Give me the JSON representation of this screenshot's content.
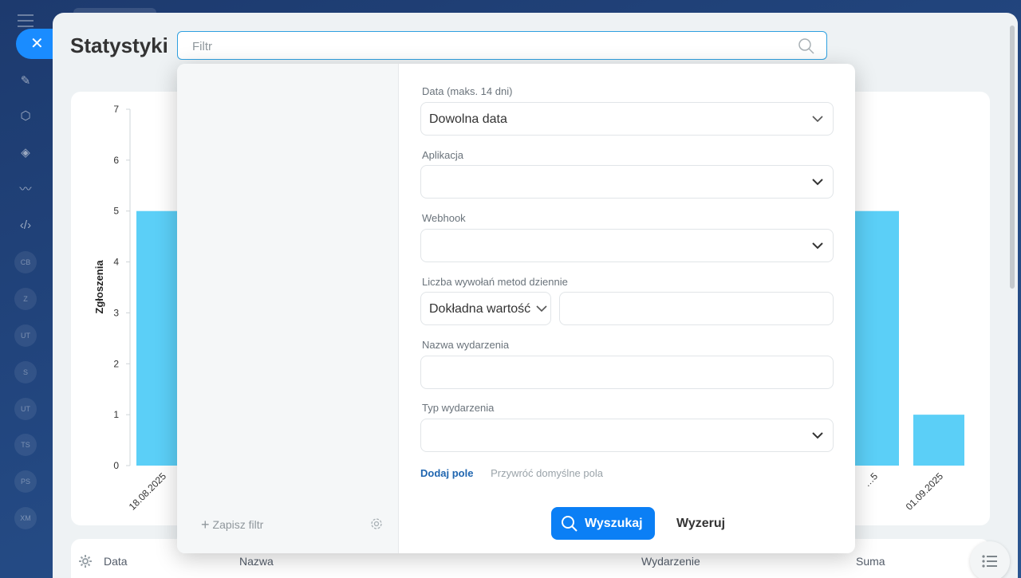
{
  "page": {
    "title": "Statystyki",
    "filter_placeholder": "Filtr"
  },
  "filter_popup": {
    "fields": [
      {
        "label": "Data (maks. 14 dni)",
        "value": "Dowolna data"
      },
      {
        "label": "Aplikacja",
        "value": ""
      },
      {
        "label": "Webhook",
        "value": ""
      },
      {
        "label": "Liczba wywołań metod dziennie",
        "value": "Dokładna wartość"
      },
      {
        "label": "Nazwa wydarzenia",
        "value": ""
      },
      {
        "label": "Typ wydarzenia",
        "value": ""
      }
    ],
    "add_field": "Dodaj pole",
    "restore_defaults": "Przywróć domyślne pola",
    "search_button": "Wyszukaj",
    "reset_button": "Wyzeruj",
    "save_filter": "Zapisz filtr"
  },
  "table": {
    "columns": [
      "Data",
      "Nazwa",
      "Wydarzenie",
      "Suma"
    ]
  },
  "rail": {
    "close_icon": "close-icon",
    "items": [
      "edit-icon",
      "hexagon-icon",
      "cube-icon",
      "waves-icon",
      "code-icon",
      "CB",
      "Z",
      "UT",
      "S",
      "UT",
      "TS",
      "PS",
      "XM"
    ]
  },
  "colors": {
    "bar": "#5bcff7",
    "accent": "#0b7ff5",
    "link": "#2066b0"
  },
  "chart_data": {
    "type": "bar",
    "ylabel": "Zgłoszenia",
    "ylim": [
      0,
      7
    ],
    "yticks": [
      0,
      1,
      2,
      3,
      4,
      5,
      6,
      7
    ],
    "categories": [
      "18.08.2025",
      "",
      "01.09.2025"
    ],
    "visible_tick_labels": [
      "18.08.2025",
      "…5",
      "01.09.2025"
    ],
    "values": [
      5,
      5,
      1
    ]
  }
}
